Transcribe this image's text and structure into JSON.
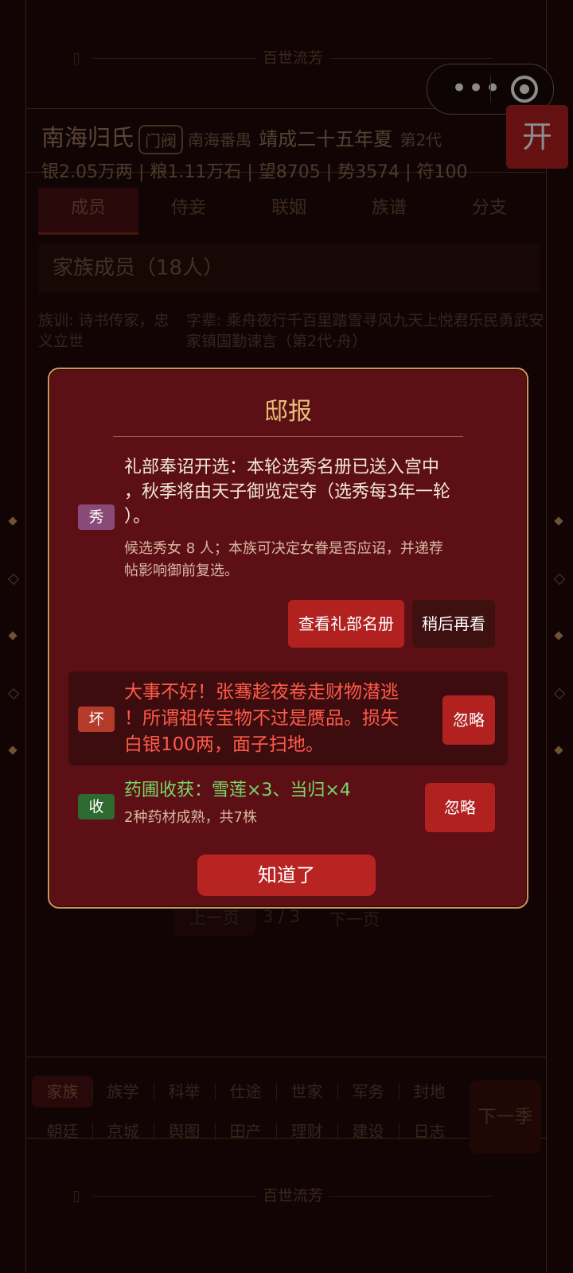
{
  "app": {
    "motto_top": "百世流芳",
    "motto_bottom": "百世流芳",
    "open_button": "开"
  },
  "header": {
    "clan_name": "南海归氏",
    "rank_badge": "门阀",
    "location": "南海番禺",
    "era": "靖成二十五年夏",
    "generation": "第2代",
    "stats": "银2.05万两 | 粮1.11万石 | 望8705 | 势3574 | 符100"
  },
  "tabs": [
    "成员",
    "侍妾",
    "联姻",
    "族谱",
    "分支"
  ],
  "members": {
    "title": "家族成员（18人）",
    "clan_motto": "族训: 诗书传家，忠义立世",
    "generation_names": "字辈: 乘舟夜行千百里踏雪寻风九天上悦君乐民勇武安家镇国勤谏言（第2代·舟）"
  },
  "pager": {
    "prev": "上一页",
    "page": "3 / 3",
    "next": "下一页"
  },
  "bottom_nav": {
    "row1": [
      "家族",
      "族学",
      "科举",
      "仕途",
      "世家",
      "军务",
      "封地"
    ],
    "row2": [
      "朝廷",
      "京城",
      "舆图",
      "田产",
      "理财",
      "建设",
      "日志"
    ],
    "next_season": "下一季"
  },
  "modal": {
    "title": "邸报",
    "events": [
      {
        "tag": "秀",
        "text_lines": [
          "礼部奉诏开选：本轮选秀名册已送入宫中",
          "，秋季将由天子御览定夺（选秀每3年一轮",
          "）。"
        ],
        "sub_lines": [
          "候选秀女 8 人；本族可决定女眷是否应诏，并递荐",
          "帖影响御前复选。"
        ],
        "primary_action": "查看礼部名册",
        "secondary_action": "稍后再看"
      },
      {
        "tag": "坏",
        "text_lines": [
          "大事不好！张骞趁夜卷走财物潜逃",
          "！所谓祖传宝物不过是赝品。损失",
          "白银100两，面子扫地。"
        ],
        "action": "忽略"
      },
      {
        "tag": "收",
        "text_lines": [
          "药圃收获：雪莲×3、当归×4"
        ],
        "sub_lines": [
          "2种药材成熟，共7株"
        ],
        "action": "忽略"
      }
    ],
    "confirm": "知道了"
  },
  "colors": {
    "accent_red": "#b02120",
    "gold": "#e6c07a",
    "tag_xiu": "#8a4a78",
    "tag_huai": "#b43a2a",
    "tag_shou": "#2e6a30",
    "bad_text": "#ff5a48",
    "good_text": "#7ad86a"
  }
}
